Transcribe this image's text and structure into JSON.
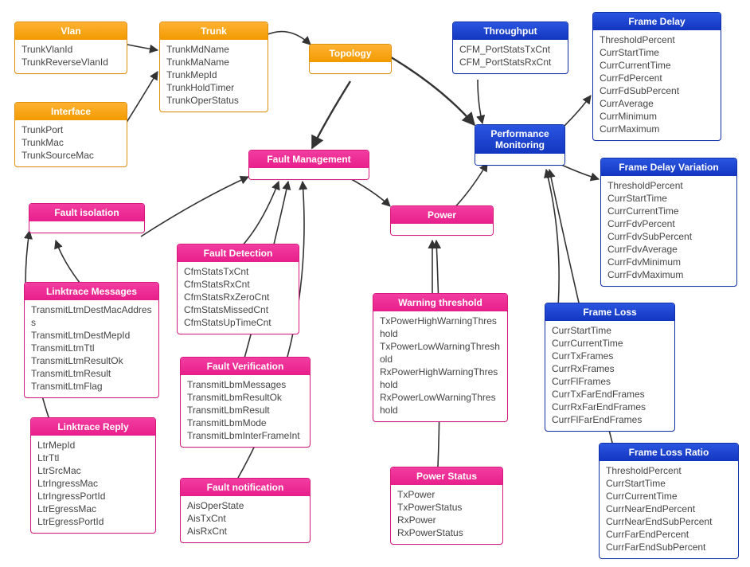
{
  "nodes": {
    "vlan": {
      "title": "Vlan",
      "fields": [
        "TrunkVlanId",
        "TrunkReverseVlanId"
      ]
    },
    "interface": {
      "title": "Interface",
      "fields": [
        "TrunkPort",
        "TrunkMac",
        "TrunkSourceMac"
      ]
    },
    "trunk": {
      "title": "Trunk",
      "fields": [
        "TrunkMdName",
        "TrunkMaName",
        "TrunkMepId",
        "TrunkHoldTimer",
        "TrunkOperStatus"
      ]
    },
    "topology": {
      "title": "Topology",
      "fields": []
    },
    "throughput": {
      "title": "Throughput",
      "fields": [
        "CFM_PortStatsTxCnt",
        "CFM_PortStatsRxCnt"
      ]
    },
    "perfmon": {
      "title": "Performance Monitoring",
      "fields": []
    },
    "framedelay": {
      "title": "Frame Delay",
      "fields": [
        "ThresholdPercent",
        "CurrStartTime",
        "CurrCurrentTime",
        "CurrFdPercent",
        "CurrFdSubPercent",
        "CurrAverage",
        "CurrMinimum",
        "CurrMaximum"
      ]
    },
    "fdv": {
      "title": "Frame Delay Variation",
      "fields": [
        "ThresholdPercent",
        "CurrStartTime",
        "CurrCurrentTime",
        "CurrFdvPercent",
        "CurrFdvSubPercent",
        "CurrFdvAverage",
        "CurrFdvMinimum",
        "CurrFdvMaximum"
      ]
    },
    "frameloss": {
      "title": "Frame Loss",
      "fields": [
        "CurrStartTime",
        "CurrCurrentTime",
        "CurrTxFrames",
        "CurrRxFrames",
        "CurrFlFrames",
        "CurrTxFarEndFrames",
        "CurrRxFarEndFrames",
        "CurrFlFarEndFrames"
      ]
    },
    "flr": {
      "title": "Frame Loss Ratio",
      "fields": [
        "ThresholdPercent",
        "CurrStartTime",
        "CurrCurrentTime",
        "CurrNearEndPercent",
        "CurrNearEndSubPercent",
        "CurrFarEndPercent",
        "CurrFarEndSubPercent"
      ]
    },
    "faultmgmt": {
      "title": "Fault Management",
      "fields": []
    },
    "faultiso": {
      "title": "Fault isolation",
      "fields": []
    },
    "faultdet": {
      "title": "Fault Detection",
      "fields": [
        "CfmStatsTxCnt",
        "CfmStatsRxCnt",
        "CfmStatsRxZeroCnt",
        "CfmStatsMissedCnt",
        "CfmStatsUpTimeCnt"
      ]
    },
    "faultver": {
      "title": "Fault Verification",
      "fields": [
        "TransmitLbmMessages",
        "TransmitLbmResultOk",
        "TransmitLbmResult",
        "TransmitLbmMode",
        "TransmitLbmInterFrameInt"
      ]
    },
    "faultnot": {
      "title": "Fault notification",
      "fields": [
        "AisOperState",
        "AisTxCnt",
        "AisRxCnt"
      ]
    },
    "linkmsg": {
      "title": "Linktrace Messages",
      "fields": [
        "TransmitLtmDestMacAddress",
        "TransmitLtmDestMepId",
        "TransmitLtmTtl",
        "TransmitLtmResultOk",
        "TransmitLtmResult",
        "TransmitLtmFlag"
      ]
    },
    "linkreply": {
      "title": "Linktrace Reply",
      "fields": [
        "LtrMepId",
        "LtrTtl",
        "LtrSrcMac",
        "LtrIngressMac",
        "LtrIngressPortId",
        "LtrEgressMac",
        "LtrEgressPortId"
      ]
    },
    "power": {
      "title": "Power",
      "fields": []
    },
    "warnthr": {
      "title": "Warning threshold",
      "fields": [
        "TxPowerHighWarningThreshold",
        "TxPowerLowWarningThreshold",
        "RxPowerHighWarningThreshold",
        "RxPowerLowWarningThreshold"
      ]
    },
    "powerstat": {
      "title": "Power Status",
      "fields": [
        "TxPower",
        "TxPowerStatus",
        "RxPower",
        "RxPowerStatus"
      ]
    }
  }
}
